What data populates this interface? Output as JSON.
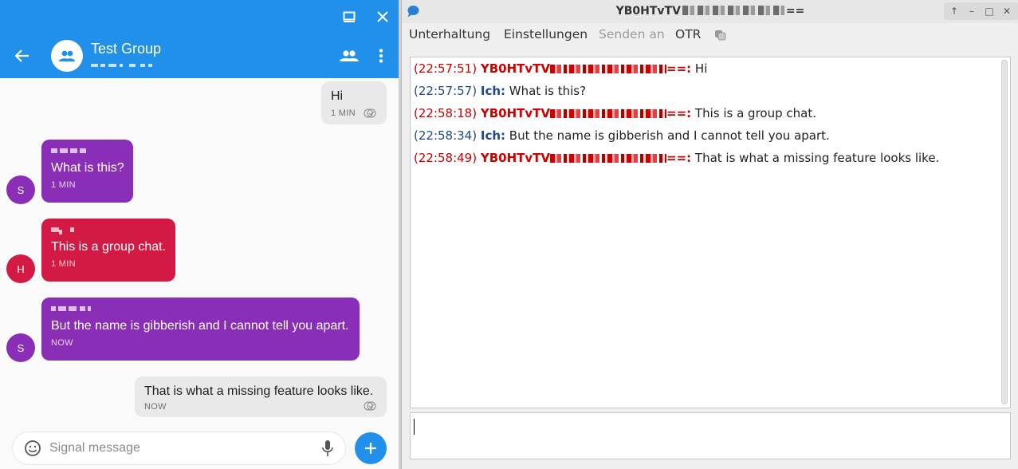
{
  "signal": {
    "header": {
      "title": "Test Group"
    },
    "composer": {
      "placeholder": "Signal message"
    },
    "messages": [
      {
        "direction": "outgoing",
        "text": "Hi",
        "time": "1 MIN"
      },
      {
        "direction": "incoming",
        "avatar_letter": "S",
        "text": "What is this?",
        "time": "1 MIN",
        "color": "#8a2eb7"
      },
      {
        "direction": "incoming",
        "avatar_letter": "H",
        "text": "This is a group chat.",
        "time": "1 MIN",
        "color": "#d21a45"
      },
      {
        "direction": "incoming",
        "avatar_letter": "S",
        "text": "But the name is gibberish and I cannot tell you apart.",
        "time": "NOW",
        "color": "#8a2eb7"
      },
      {
        "direction": "outgoing",
        "text": "That is what a missing feature looks like.",
        "time": "NOW"
      }
    ],
    "colors": {
      "accent": "#2090ea",
      "outgoing_bubble": "#e9e9e9",
      "sender_purple": "#8a2eb7",
      "sender_red": "#d21a45"
    }
  },
  "pidgin": {
    "title_prefix": "YB0HTvTV",
    "title_suffix": "==",
    "menu": [
      {
        "label": "Unterhaltung",
        "enabled": true
      },
      {
        "label": "Einstellungen",
        "enabled": true
      },
      {
        "label": "Senden an",
        "enabled": false
      },
      {
        "label": "OTR",
        "enabled": true
      }
    ],
    "log": [
      {
        "ts": "(22:57:51)",
        "nick_prefix": "YB0HTvTV",
        "nick_suffix": "==:",
        "self": false,
        "text": "Hi"
      },
      {
        "ts": "(22:57:57)",
        "nick": "Ich:",
        "self": true,
        "text": "What is this?"
      },
      {
        "ts": "(22:58:18)",
        "nick_prefix": "YB0HTvTV",
        "nick_suffix": "==:",
        "self": false,
        "text": "This is a group chat."
      },
      {
        "ts": "(22:58:34)",
        "nick": "Ich:",
        "self": true,
        "text": "But the name is gibberish and I cannot tell you apart."
      },
      {
        "ts": "(22:58:49)",
        "nick_prefix": "YB0HTvTV",
        "nick_suffix": "==:",
        "self": false,
        "text": "That is what a missing feature looks like."
      }
    ],
    "colors": {
      "remote_nick": "#cc0000",
      "self_nick": "#204a87"
    }
  }
}
